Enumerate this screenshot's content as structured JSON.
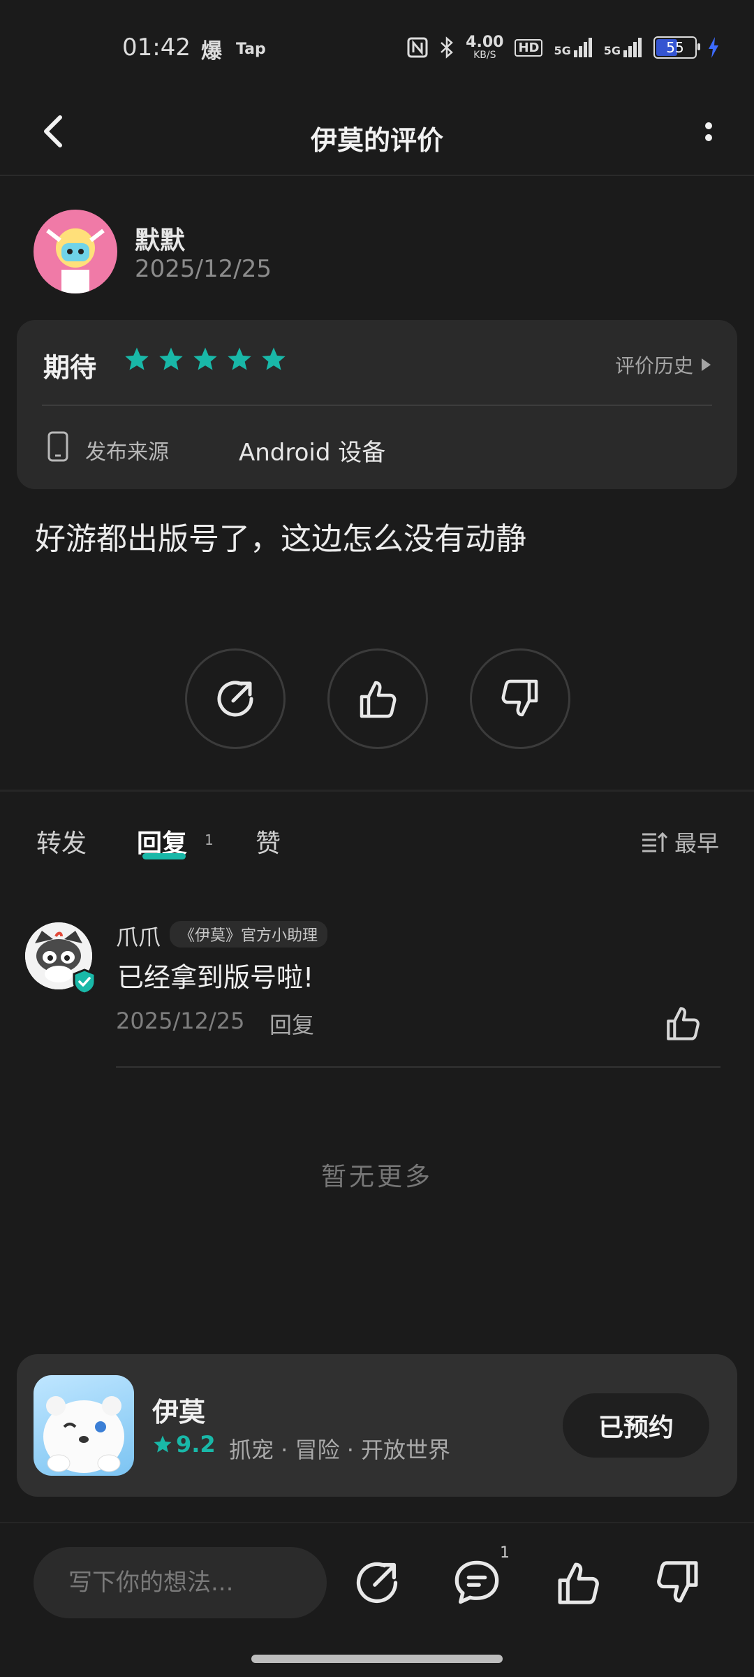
{
  "status_bar": {
    "time": "01:42",
    "app_icons": [
      "爆",
      "Tap"
    ],
    "net_speed": "4.00",
    "net_unit": "KB/S",
    "hd": "HD",
    "signal1": "5G",
    "signal2": "5G",
    "battery": "55",
    "battery_level": 0.55
  },
  "header": {
    "title": "伊莫的评价"
  },
  "review": {
    "author_name": "默默",
    "author_date": "2025/12/25",
    "rating_label": "期待",
    "stars": 5,
    "history_label": "评价历史",
    "source_label": "发布来源",
    "source_value": "Android 设备",
    "text": "好游都出版号了，这边怎么没有动静"
  },
  "tabs": {
    "forward": "转发",
    "reply": "回复",
    "reply_count": "1",
    "like": "赞",
    "sort_label": "最早"
  },
  "reply_item": {
    "name": "爪爪",
    "badge": "《伊莫》官方小助理",
    "text": "已经拿到版号啦!",
    "date": "2025/12/25",
    "reply_label": "回复"
  },
  "no_more": "暂无更多",
  "game": {
    "name": "伊莫",
    "score": "9.2",
    "tags": "抓宠 · 冒险 · 开放世界",
    "button": "已预约"
  },
  "bottom_bar": {
    "placeholder": "写下你的想法...",
    "comment_count": "1"
  },
  "colors": {
    "accent": "#19b8a8",
    "background": "#1b1b1b",
    "card": "#2a2a2a"
  }
}
